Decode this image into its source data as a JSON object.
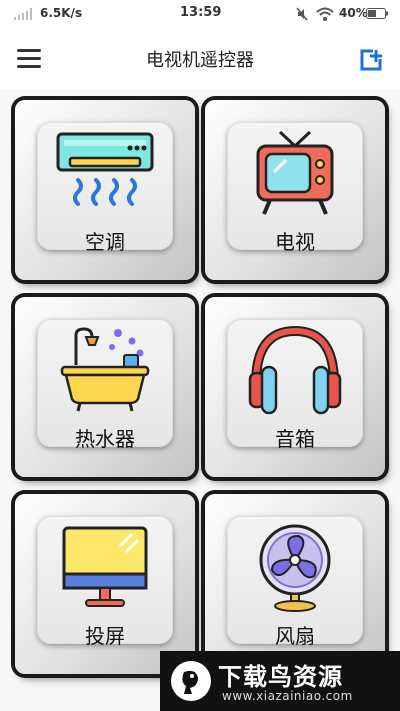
{
  "status_bar": {
    "net_speed": "6.5K/s",
    "time": "13:59",
    "battery": "40%"
  },
  "app_bar": {
    "title": "电视机遥控器"
  },
  "devices": [
    {
      "label": "空调",
      "icon": "air-conditioner-icon"
    },
    {
      "label": "电视",
      "icon": "tv-icon"
    },
    {
      "label": "热水器",
      "icon": "water-heater-bathtub-icon"
    },
    {
      "label": "音箱",
      "icon": "headphones-icon"
    },
    {
      "label": "投屏",
      "icon": "monitor-icon"
    },
    {
      "label": "风扇",
      "icon": "fan-icon"
    }
  ],
  "watermark": {
    "text": "下载鸟资源",
    "url": "www.xiazainiao.com"
  }
}
